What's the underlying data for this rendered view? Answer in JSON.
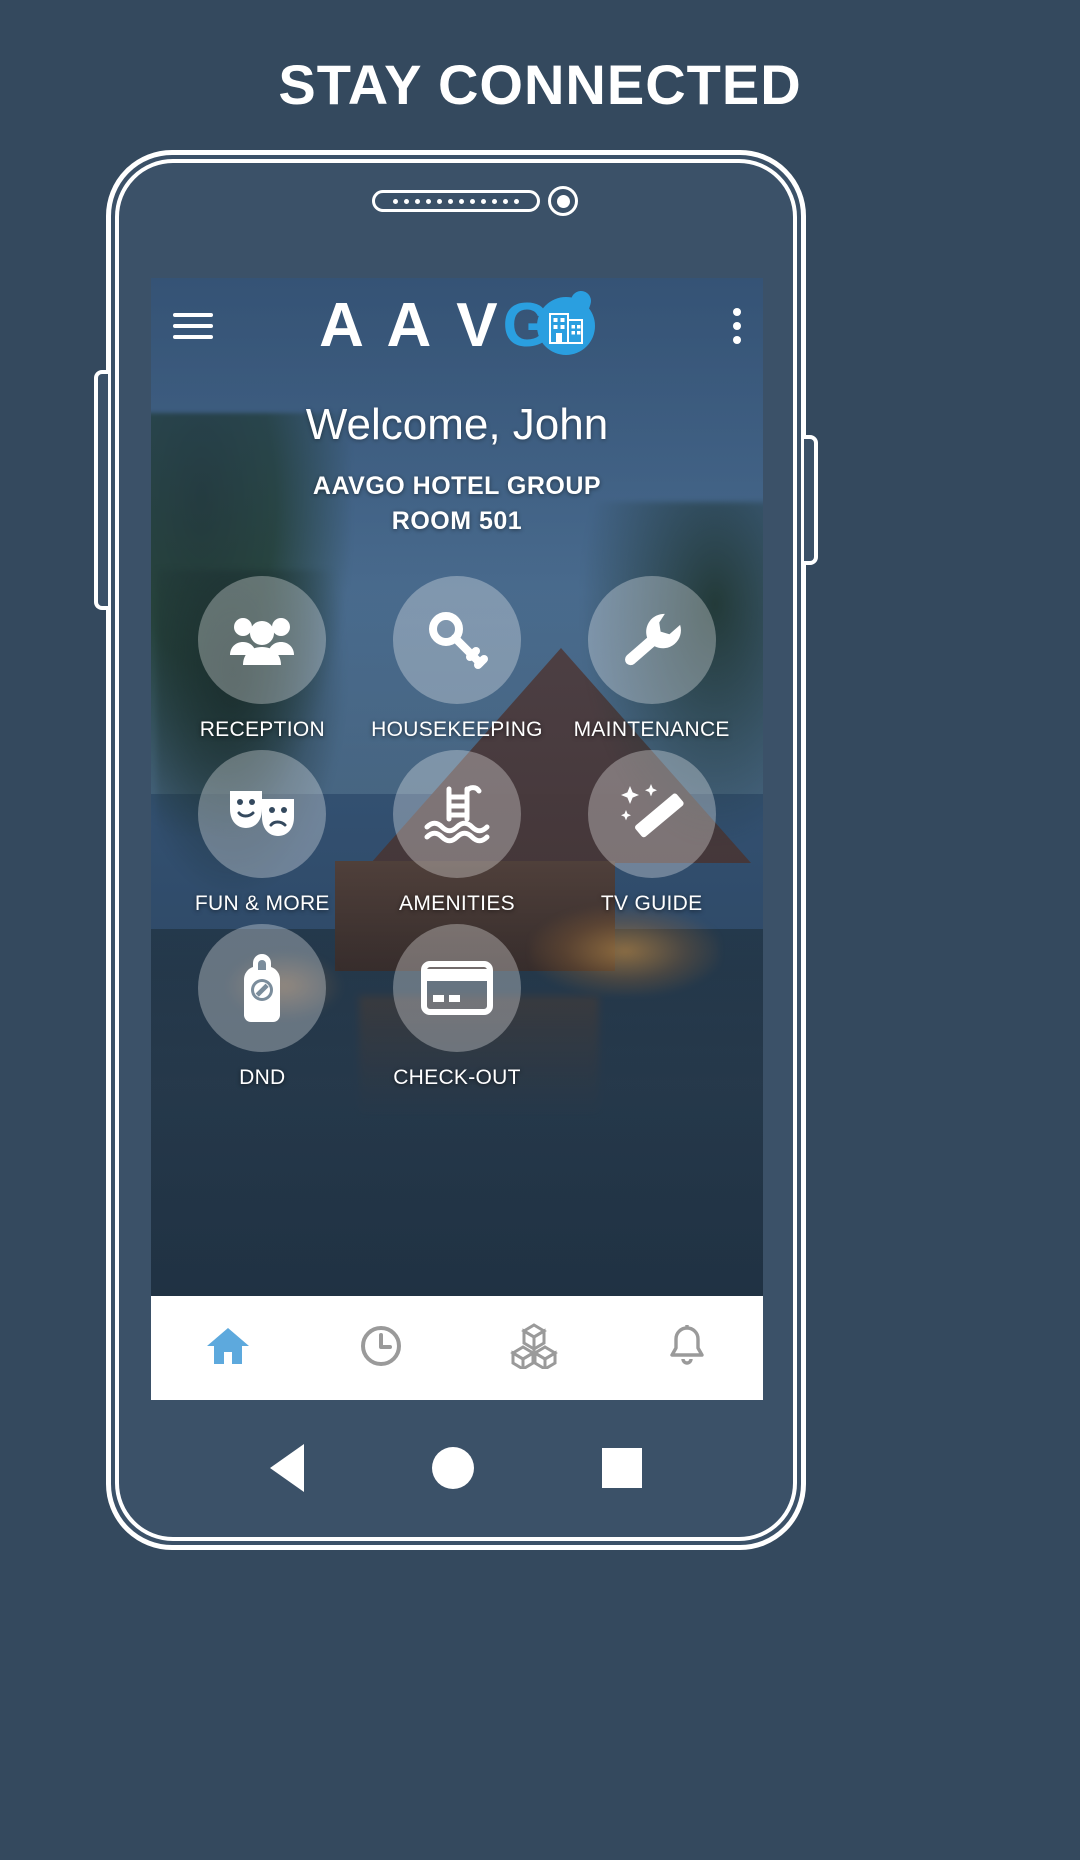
{
  "page": {
    "heading": "STAY CONNECTED",
    "background_color": "#34495e"
  },
  "device": {
    "frame_color": "#3b5168",
    "outline_color": "#ffffff",
    "speaker_name": "earpiece-speaker",
    "camera_name": "front-camera"
  },
  "app": {
    "appbar": {
      "menu_icon": "hamburger-menu-icon",
      "overflow_icon": "kebab-menu-icon",
      "logo": {
        "text_primary": "A A V",
        "text_accent": "G",
        "badge_icon": "hotel-building-icon",
        "accent_color": "#2a9fe0"
      }
    },
    "header": {
      "welcome": "Welcome, John",
      "hotel_group": "AAVGO HOTEL GROUP",
      "room": "ROOM 501"
    },
    "tiles": [
      {
        "label": "RECEPTION",
        "icon": "people-group-icon"
      },
      {
        "label": "HOUSEKEEPING",
        "icon": "key-icon"
      },
      {
        "label": "MAINTENANCE",
        "icon": "wrench-icon"
      },
      {
        "label": "FUN & MORE",
        "icon": "theater-masks-icon"
      },
      {
        "label": "AMENITIES",
        "icon": "swimming-pool-icon"
      },
      {
        "label": "TV GUIDE",
        "icon": "magic-wand-icon"
      },
      {
        "label": "DND",
        "icon": "door-hanger-icon"
      },
      {
        "label": "CHECK-OUT",
        "icon": "credit-card-icon"
      }
    ],
    "bottom_nav": [
      {
        "name": "home",
        "icon": "home-icon",
        "active": true
      },
      {
        "name": "history",
        "icon": "clock-icon",
        "active": false
      },
      {
        "name": "services",
        "icon": "cubes-icon",
        "active": false
      },
      {
        "name": "notifications",
        "icon": "bell-icon",
        "active": false
      }
    ],
    "nav_active_color": "#5da9dd",
    "nav_inactive_color": "#9a9a9a"
  },
  "softkeys": [
    {
      "name": "back",
      "icon": "triangle-back-icon"
    },
    {
      "name": "home",
      "icon": "circle-home-icon"
    },
    {
      "name": "recent",
      "icon": "square-recents-icon"
    }
  ]
}
